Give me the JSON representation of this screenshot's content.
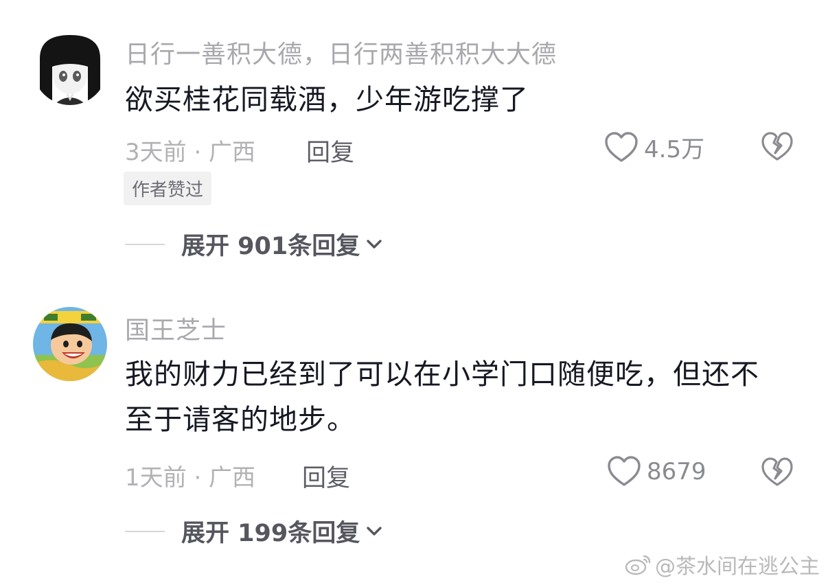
{
  "comments": [
    {
      "avatar_icon": "anime-girl-avatar-icon",
      "username": "日行一善积大德，日行两善积积大大德",
      "text_lines": [
        "欲买桂花同载酒，少年游吃撑了"
      ],
      "time_location": "3天前 · 广西",
      "reply_label": "回复",
      "like_count": "4.5万",
      "author_liked_badge": "作者赞过",
      "expand_label": "展开 901条回复"
    },
    {
      "avatar_icon": "cartoon-boy-avatar-icon",
      "username": "国王芝士",
      "text_lines": [
        "我的财力已经到了可以在小学门口随便吃，但还不",
        "至于请客的地步。"
      ],
      "time_location": "1天前 · 广西",
      "reply_label": "回复",
      "like_count": "8679",
      "expand_label": "展开 199条回复"
    }
  ],
  "watermark": {
    "icon": "weibo-icon",
    "text": "@茶水间在逃公主"
  },
  "colors": {
    "username": "#a8a8ad",
    "text": "#161823",
    "meta": "#b2b2b6",
    "reply": "#5d5e66",
    "badge_bg": "#f1f1f2"
  }
}
